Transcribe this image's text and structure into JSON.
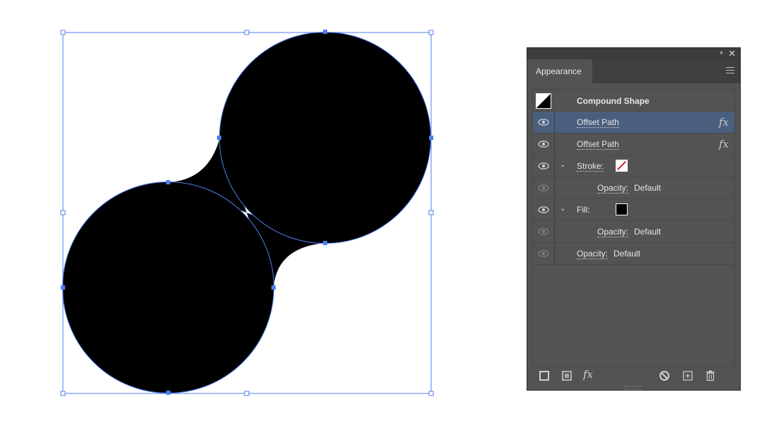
{
  "panel": {
    "tab_label": "Appearance",
    "collapse_label": "‹‹",
    "close_label": "✕",
    "rows": [
      {
        "label": "Compound Shape",
        "type": "object"
      },
      {
        "label": "Offset Path",
        "fx": "fx",
        "selected": true
      },
      {
        "label": "Offset Path",
        "fx": "fx"
      },
      {
        "label": "Stroke:",
        "type": "stroke"
      },
      {
        "label": "Opacity:",
        "value": "Default"
      },
      {
        "label": "Fill:",
        "type": "fill"
      },
      {
        "label": "Opacity:",
        "value": "Default"
      },
      {
        "label": "Opacity:",
        "value": "Default"
      }
    ],
    "bottom_icons": [
      "add-new-stroke-icon",
      "add-new-fill-icon",
      "add-new-effect-icon",
      "clear-appearance-icon",
      "duplicate-item-icon",
      "delete-item-icon"
    ],
    "fx_menu_label": "fx",
    "colors": {
      "selection": "#4a5f7e",
      "stroke_slash": "#d0021b",
      "artboard_selection": "#4f7ef0"
    }
  }
}
